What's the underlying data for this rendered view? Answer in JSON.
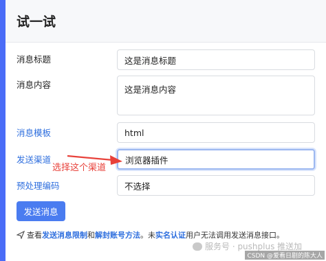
{
  "card": {
    "title": "试一试"
  },
  "form": {
    "title_label": "消息标题",
    "title_value": "这是消息标题",
    "content_label": "消息内容",
    "content_value": "这是消息内容",
    "template_label": "消息模板",
    "template_value": "html",
    "channel_label": "发送渠道",
    "channel_value": "浏览器插件",
    "preprocess_label": "预处理编码",
    "preprocess_value": "不选择",
    "submit_label": "发送消息"
  },
  "annotation": {
    "text": "选择这个渠道",
    "color": "#e8413a"
  },
  "footer": {
    "prefix": "查看",
    "link1": "发送消息限制",
    "and": "和",
    "link2": "解封账号方法",
    "mid": "。未",
    "link3": "实名认证",
    "suffix": "用户无法调用发送消息接口。"
  },
  "watermark": {
    "text": "服务号 · pushplus 推送加",
    "csdn": "CSDN @爱看日剧的陈大人"
  },
  "colors": {
    "accent": "#4a7cf0",
    "link": "#2f6fde",
    "background": "#4a6cf7"
  }
}
